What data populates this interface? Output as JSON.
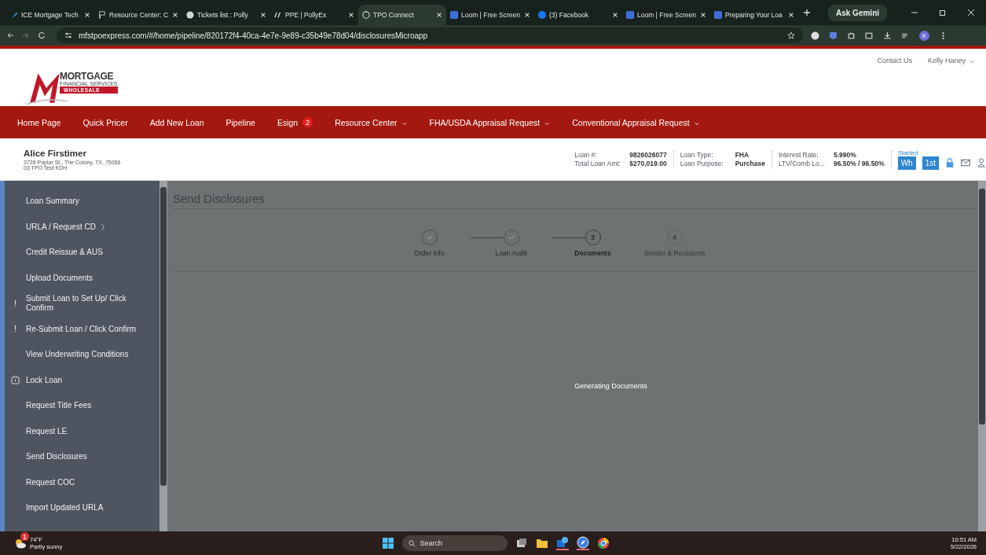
{
  "browser": {
    "tabs": [
      {
        "title": "ICE Mortgage Tech",
        "kind": "wrench",
        "selected": false
      },
      {
        "title": "Resource Center: C",
        "kind": "flag",
        "selected": false
      },
      {
        "title": "Tickets list : Polly",
        "kind": "badge",
        "selected": false
      },
      {
        "title": "PPE | PollyEx",
        "kind": "slashes",
        "selected": false
      },
      {
        "title": "TPO Connect",
        "kind": "globe",
        "selected": true
      },
      {
        "title": "Loom | Free Screen",
        "kind": "square",
        "selected": false
      },
      {
        "title": "(3) Facebook",
        "kind": "circle",
        "selected": false
      },
      {
        "title": "Loom | Free Screen",
        "kind": "square",
        "selected": false
      },
      {
        "title": "Preparing Your Loa",
        "kind": "square",
        "selected": false
      }
    ],
    "gemini": "Ask Gemini",
    "url": "mfstpoexpress.com/#/home/pipeline/820172f4-40ca-4e7e-9e89-c35b49e78d04/disclosuresMicroapp",
    "profile": "K"
  },
  "header": {
    "logo": {
      "word": "MORTGAGE",
      "sub": "FINANCIAL SERVICES",
      "tag": "WHOLESALE"
    },
    "links": [
      "Contact Us",
      "Kelly Haney"
    ]
  },
  "nav": [
    {
      "label": "Home Page",
      "dropdown": false
    },
    {
      "label": "Quick Pricer",
      "dropdown": false
    },
    {
      "label": "Add New Loan",
      "dropdown": false
    },
    {
      "label": "Pipeline",
      "dropdown": false
    },
    {
      "label": "Esign",
      "dropdown": false,
      "badge": "2"
    },
    {
      "label": "Resource Center",
      "dropdown": true
    },
    {
      "label": "FHA/USDA Appraisal Request",
      "dropdown": true
    },
    {
      "label": "Conventional Appraisal Request",
      "dropdown": true
    }
  ],
  "borrower": {
    "name": "Alice Firstimer",
    "address": "3726 Poplar St., The Colony, TX, 75056",
    "company": "03 TPO Test KDH"
  },
  "loan_info": [
    [
      {
        "label": "Loan #:",
        "value": "9826026077"
      },
      {
        "label": "Total Loan Amt:",
        "value": "$270,019.00"
      }
    ],
    [
      {
        "label": "Loan Type:",
        "value": "FHA"
      },
      {
        "label": "Loan Purpose:",
        "value": "Purchase"
      }
    ],
    [
      {
        "label": "Interest Rate:",
        "value": "5.990%"
      },
      {
        "label": "LTV/Comb Lo...",
        "value": "96.50% / 96.50%"
      }
    ]
  ],
  "status": {
    "label": "Started",
    "buttons": [
      "Wh",
      "1st"
    ]
  },
  "sidebar": [
    {
      "label": "Loan Summary",
      "kind": "plain"
    },
    {
      "label": "URLA / Request CD",
      "kind": "submenu"
    },
    {
      "label": "Credit Reissue & AUS",
      "kind": "plain"
    },
    {
      "label": "Upload Documents",
      "kind": "plain"
    },
    {
      "label": "Submit Loan to Set Up/ Click Confirm",
      "kind": "alert",
      "mark": "!"
    },
    {
      "label": "Re-Submit Loan / Click Confirm",
      "kind": "alert",
      "mark": "!"
    },
    {
      "label": "View Underwriting Conditions",
      "kind": "plain"
    },
    {
      "label": "Lock Loan",
      "kind": "lock"
    },
    {
      "label": "Request Title Fees",
      "kind": "plain"
    },
    {
      "label": "Request LE",
      "kind": "plain"
    },
    {
      "label": "Send Disclosures",
      "kind": "plain"
    },
    {
      "label": "Request COC",
      "kind": "plain"
    },
    {
      "label": "Import Updated URLA",
      "kind": "plain"
    }
  ],
  "page_title": "Send Disclosures",
  "steps": [
    {
      "label": "Order Info",
      "done": true,
      "current": false
    },
    {
      "label": "Loan Audit",
      "done": true,
      "current": false
    },
    {
      "label": "Documents",
      "number": "3",
      "done": false,
      "current": true
    },
    {
      "label": "Sender & Recipients",
      "number": "4",
      "done": false,
      "current": false
    }
  ],
  "message": "Generating Documents",
  "taskbar": {
    "temp": "74°F",
    "weather": "Partly sunny",
    "weather_badge": "1",
    "search": "Search",
    "time": "10:51 AM",
    "date": "5/22/2026"
  }
}
